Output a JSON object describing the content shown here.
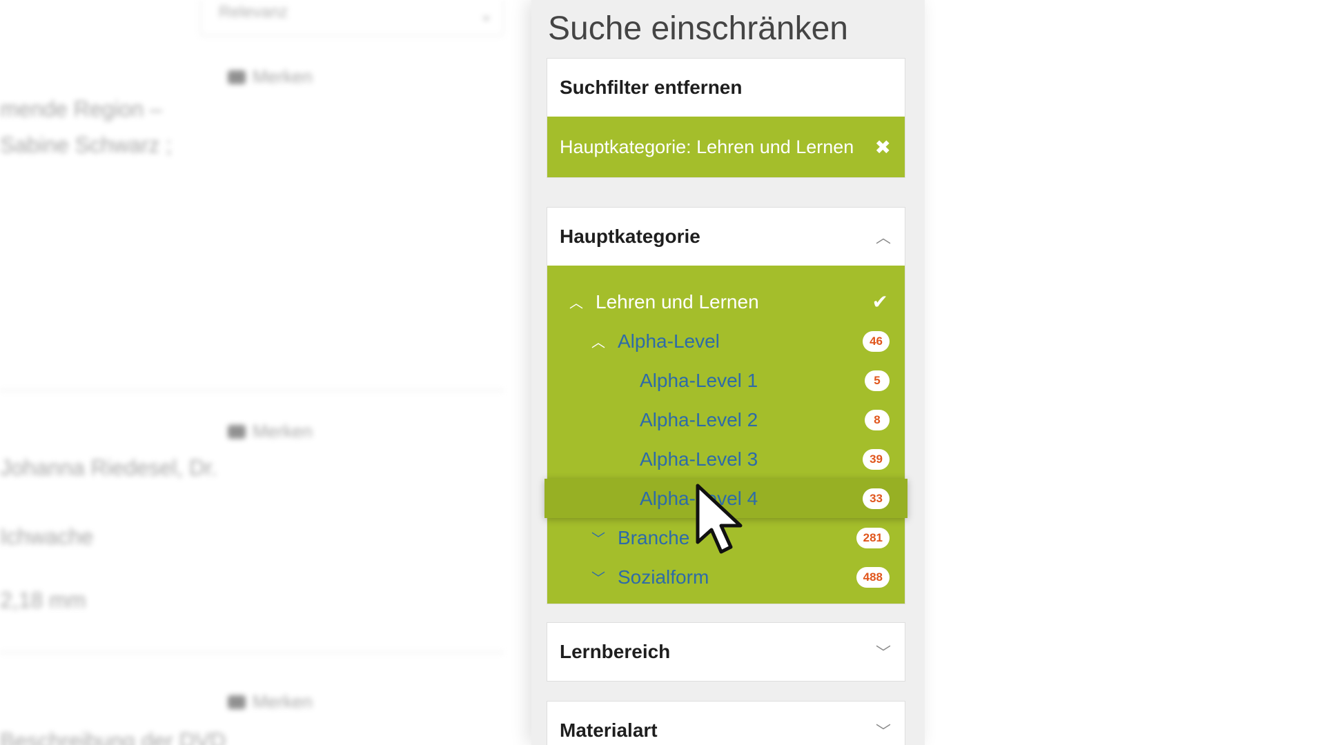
{
  "background": {
    "select_value": "Relevanz",
    "items": [
      "mende Region –",
      "Sabine Schwarz ;",
      "Johanna Riedesel, Dr.",
      "Ichwache",
      "2,18 mm",
      "Beschreibung der DVD"
    ],
    "mark_label": "Merken"
  },
  "sidebar": {
    "title": "Suche einschränken",
    "remove_filters": {
      "title": "Suchfilter entfernen",
      "active_filter": "Hauptkategorie: Lehren und Lernen"
    },
    "hauptkategorie": {
      "title": "Hauptkategorie",
      "items": [
        {
          "label": "Lehren und Lernen"
        },
        {
          "label": "Alpha-Level",
          "count": "46"
        },
        {
          "label": "Alpha-Level 1",
          "count": "5"
        },
        {
          "label": "Alpha-Level 2",
          "count": "8"
        },
        {
          "label": "Alpha-Level 3",
          "count": "39"
        },
        {
          "label": "Alpha-Level 4",
          "count": "33"
        },
        {
          "label": "Branche",
          "count": "281"
        },
        {
          "label": "Sozialform",
          "count": "488"
        }
      ]
    },
    "lernbereich": {
      "title": "Lernbereich"
    },
    "materialart": {
      "title": "Materialart"
    }
  },
  "colors": {
    "accent_green": "#a4be2b",
    "link_blue": "#2d6ba8",
    "badge_orange": "#e0551b"
  }
}
